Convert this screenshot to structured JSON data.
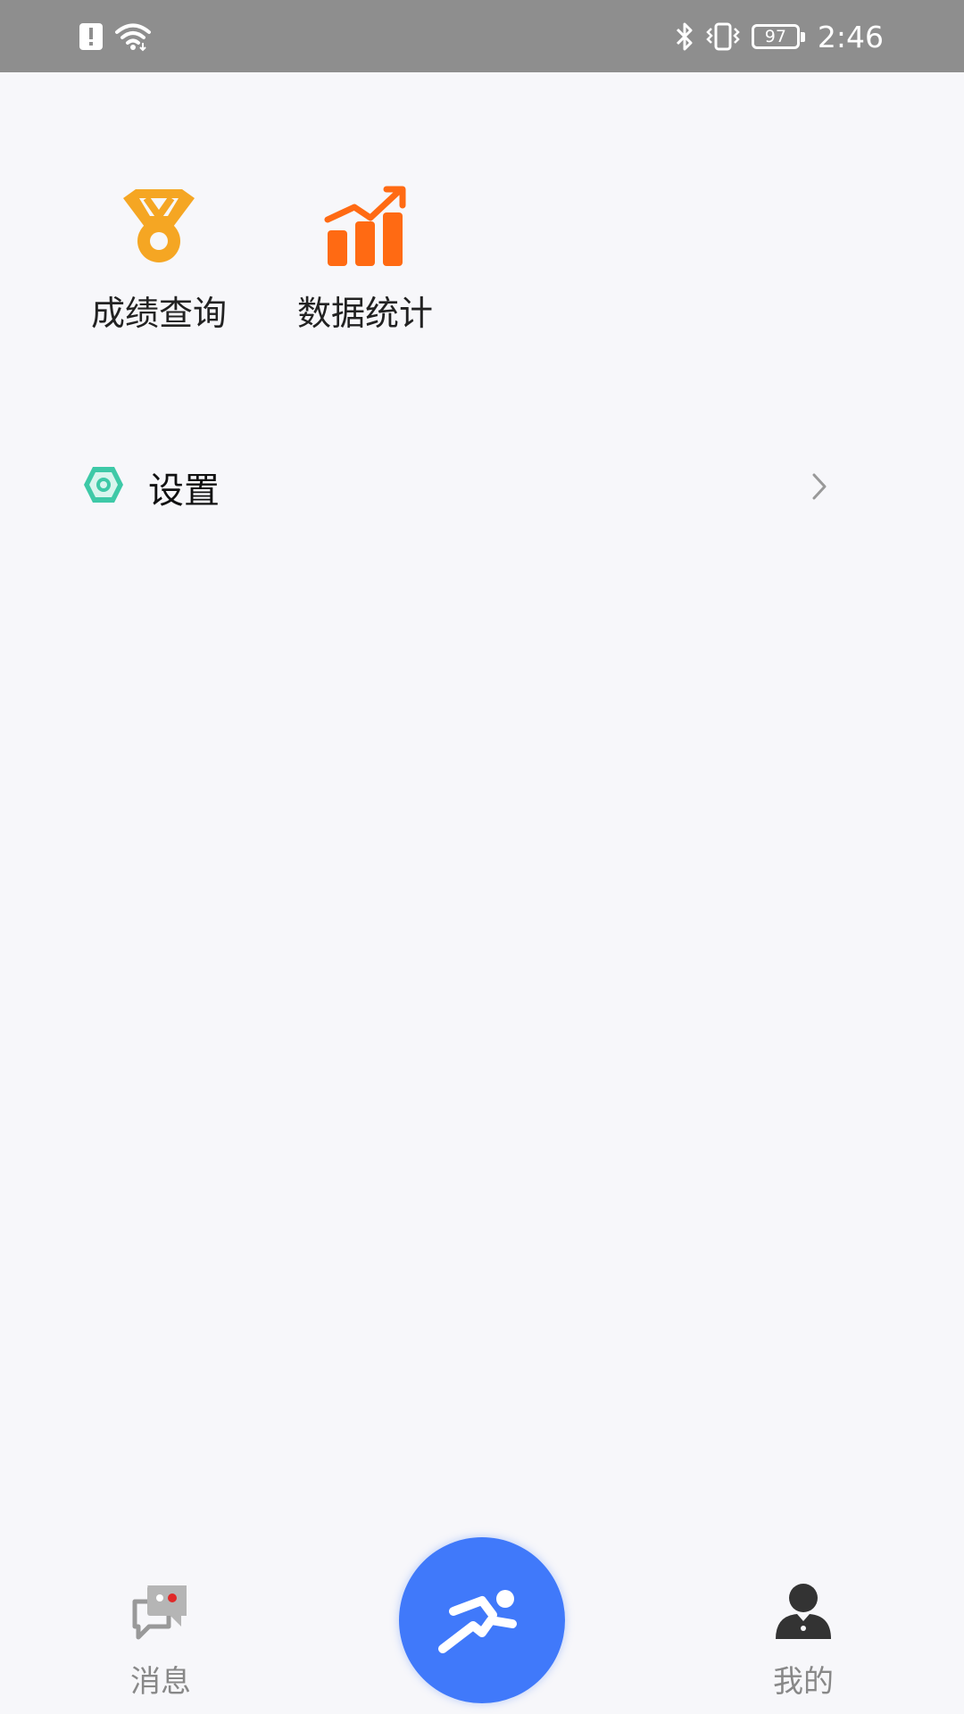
{
  "status_bar": {
    "time": "2:46",
    "battery_level": "97",
    "icons": [
      "alert-icon",
      "wifi-icon",
      "bluetooth-icon",
      "vibrate-icon",
      "battery-icon"
    ]
  },
  "shortcuts": [
    {
      "label": "成绩查询",
      "icon": "medal-icon",
      "color": "#f5a623"
    },
    {
      "label": "数据统计",
      "icon": "bar-chart-trend-icon",
      "color": "#ff6a13"
    }
  ],
  "settings": {
    "label": "设置",
    "icon": "hexagon-gear-icon",
    "color": "#3ec9a7"
  },
  "tabbar": {
    "messages_label": "消息",
    "profile_label": "我的",
    "center_icon": "running-man-icon",
    "accent": "#4079fa"
  }
}
